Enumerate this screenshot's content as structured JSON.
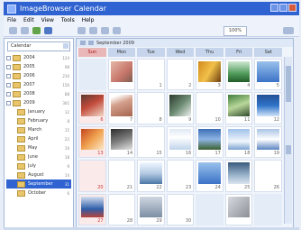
{
  "window": {
    "title": "ImageBrowser Calendar"
  },
  "menu": {
    "items": [
      "File",
      "Edit",
      "View",
      "Tools",
      "Help"
    ]
  },
  "toolbar": {
    "zoom": "100%"
  },
  "sidebar": {
    "combo_value": "Calendar",
    "tree": [
      {
        "label": "2004",
        "count": "124",
        "child": false,
        "selected": false
      },
      {
        "label": "2005",
        "count": "98",
        "child": false,
        "selected": false
      },
      {
        "label": "2006",
        "count": "210",
        "child": false,
        "selected": false
      },
      {
        "label": "2007",
        "count": "156",
        "child": false,
        "selected": false
      },
      {
        "label": "2008",
        "count": "88",
        "child": false,
        "selected": false
      },
      {
        "label": "2009",
        "count": "301",
        "child": false,
        "selected": false
      },
      {
        "label": "January",
        "count": "12",
        "child": true,
        "selected": false
      },
      {
        "label": "February",
        "count": "8",
        "child": true,
        "selected": false
      },
      {
        "label": "March",
        "count": "15",
        "child": true,
        "selected": false
      },
      {
        "label": "April",
        "count": "22",
        "child": true,
        "selected": false
      },
      {
        "label": "May",
        "count": "10",
        "child": true,
        "selected": false
      },
      {
        "label": "June",
        "count": "18",
        "child": true,
        "selected": false
      },
      {
        "label": "July",
        "count": "9",
        "child": true,
        "selected": false
      },
      {
        "label": "August",
        "count": "14",
        "child": true,
        "selected": false
      },
      {
        "label": "September",
        "count": "31",
        "child": true,
        "selected": true
      },
      {
        "label": "October",
        "count": "6",
        "child": true,
        "selected": false
      }
    ]
  },
  "calendar": {
    "month_label": "September 2009",
    "weekdays": [
      "Sun",
      "Mon",
      "Tue",
      "Wed",
      "Thu",
      "Fri",
      "Sat"
    ],
    "rows": [
      [
        {
          "day": "",
          "empty": true
        },
        {
          "day": "",
          "photo": "p1"
        },
        {
          "day": "1",
          "photo": ""
        },
        {
          "day": "2",
          "photo": ""
        },
        {
          "day": "3",
          "photo": "p3"
        },
        {
          "day": "4",
          "photo": "p4"
        },
        {
          "day": "5",
          "photo": "p5"
        }
      ],
      [
        {
          "day": "6",
          "photo": "p7"
        },
        {
          "day": "7",
          "photo": "p2"
        },
        {
          "day": "8",
          "photo": ""
        },
        {
          "day": "9",
          "photo": "p6"
        },
        {
          "day": "10",
          "photo": ""
        },
        {
          "day": "11",
          "photo": "p14"
        },
        {
          "day": "12",
          "photo": "p13"
        }
      ],
      [
        {
          "day": "13",
          "photo": "p9"
        },
        {
          "day": "14",
          "photo": "p10"
        },
        {
          "day": "15",
          "photo": ""
        },
        {
          "day": "16",
          "photo": "p11"
        },
        {
          "day": "17",
          "photo": "p12"
        },
        {
          "day": "18",
          "photo": "p15"
        },
        {
          "day": "19",
          "photo": "p16"
        }
      ],
      [
        {
          "day": "20",
          "photo": ""
        },
        {
          "day": "21",
          "photo": ""
        },
        {
          "day": "22",
          "photo": "p8"
        },
        {
          "day": "23",
          "photo": ""
        },
        {
          "day": "24",
          "photo": "p5"
        },
        {
          "day": "25",
          "photo": "p18"
        },
        {
          "day": "26",
          "photo": ""
        }
      ],
      [
        {
          "day": "27",
          "photo": "p17"
        },
        {
          "day": "28",
          "photo": ""
        },
        {
          "day": "29",
          "photo": "p19"
        },
        {
          "day": "30",
          "photo": ""
        },
        {
          "day": "",
          "empty": true
        },
        {
          "day": "",
          "photo": "p20"
        },
        {
          "day": "",
          "empty": true
        }
      ]
    ]
  }
}
